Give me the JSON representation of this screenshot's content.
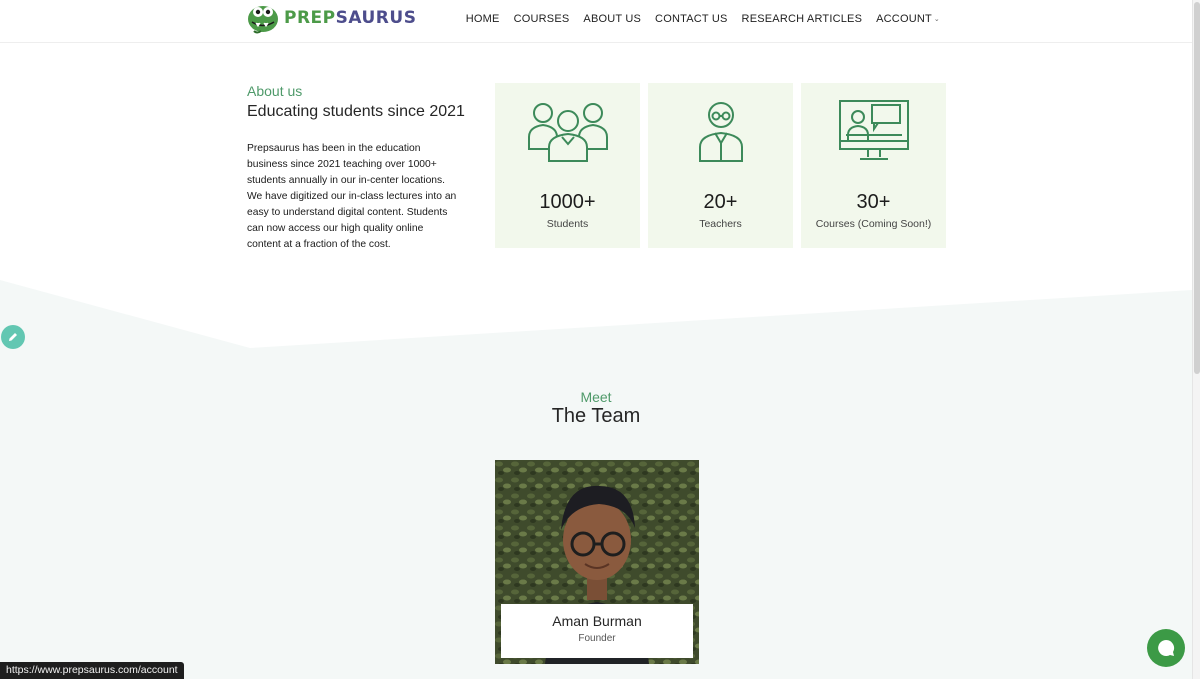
{
  "brand": {
    "prefix": "PREP",
    "suffix": "SAURUS",
    "primary_color": "#4c9a48",
    "secondary_color": "#4d4d8c"
  },
  "nav": {
    "items": [
      "HOME",
      "COURSES",
      "ABOUT US",
      "CONTACT US",
      "RESEARCH ARTICLES"
    ],
    "account": "ACCOUNT"
  },
  "about": {
    "label": "About us",
    "title": "Educating students since 2021",
    "body": "Prepsaurus has been in the education business since 2021 teaching over 1000+ students annually in our in-center locations. We have digitized our in-class lectures into an easy to understand digital content. Students can now access our high quality online content at a fraction of the cost."
  },
  "stats": [
    {
      "value": "1000+",
      "label": "Students",
      "icon": "students-group-icon"
    },
    {
      "value": "20+",
      "label": "Teachers",
      "icon": "teacher-icon"
    },
    {
      "value": "30+",
      "label": "Courses (Coming Soon!)",
      "icon": "online-course-icon"
    }
  ],
  "team": {
    "label": "Meet",
    "title": "The Team",
    "members": [
      {
        "name": "Aman Burman",
        "role": "Founder"
      }
    ]
  },
  "status_url": "https://www.prepsaurus.com/account",
  "colors": {
    "accent_green": "#4f9a6a",
    "card_bg": "#f2f8ec",
    "chat_green": "#3c9a46",
    "fab_teal": "#62c7b2"
  }
}
